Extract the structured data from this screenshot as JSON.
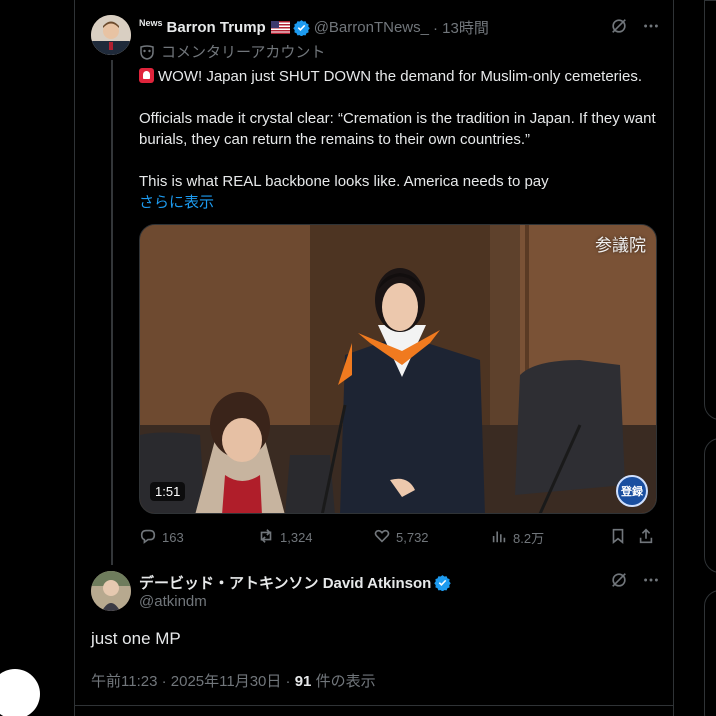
{
  "tweet1": {
    "news_tag": "News",
    "name": "Barron Trump",
    "handle": "@BarronTNews_",
    "time": "· 13時間",
    "commentary_label": "コメンタリーアカウント",
    "lines": [
      "WOW! Japan just SHUT DOWN the demand for Muslim-only cemeteries.",
      "Officials made it crystal clear: “Cremation is the tradition in Japan. If they want",
      "burials, they can return the remains to their own countries.”",
      "This is what REAL backbone looks like. America needs to pay"
    ],
    "show_more": "さらに表示",
    "media": {
      "corner_label": "参議院",
      "duration": "1:51",
      "badge": "登録"
    },
    "actions": {
      "replies": "163",
      "reposts": "1,324",
      "likes": "5,732",
      "views": "8.2万"
    }
  },
  "tweet2": {
    "name": "デービッド・アトキンソン David Atkinson",
    "handle": "@atkindm",
    "text": "just one MP",
    "meta_prefix": "午前11:23 · 2025年11月30日 · ",
    "views_count": "91",
    "views_suffix": " 件の表示"
  },
  "colors": {
    "background": "#000000",
    "text": "#e7e9ea",
    "muted": "#71767b",
    "link": "#1d9bf0",
    "verified": "#1d9bf0",
    "border": "#2f3336"
  },
  "icons": [
    "grok-icon",
    "more-icon",
    "reply-icon",
    "repost-icon",
    "like-icon",
    "views-icon",
    "bookmark-icon",
    "share-icon",
    "verified-icon",
    "us-flag-icon",
    "mask-icon",
    "siren-icon"
  ]
}
